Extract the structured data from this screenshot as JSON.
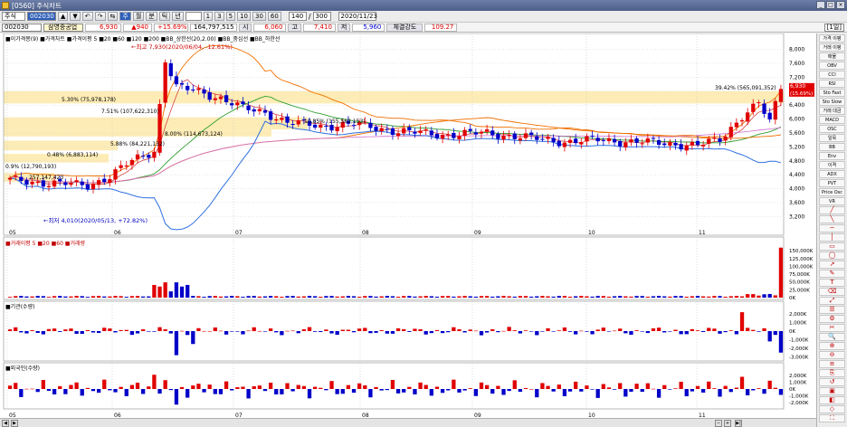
{
  "window": {
    "title": "[0560] 주식차트"
  },
  "toolbar": {
    "market": "주식",
    "code": "002030",
    "nav": [
      "▲",
      "▼",
      "↶",
      "↷",
      "⇆"
    ],
    "period_buttons": [
      "주",
      "월",
      "분",
      "틱",
      "년"
    ],
    "minute_buttons": [
      "1",
      "3",
      "5",
      "10",
      "30",
      "60"
    ],
    "count": "140",
    "count_total": "300",
    "date": "2020/11/23"
  },
  "infobar": {
    "code": "002030",
    "name": "삼영중공업",
    "price": "6,930",
    "change": "▲940",
    "change_pct": "+15.69%",
    "volume": "164,797,515",
    "open_label": "시",
    "open": "6,060",
    "high_label": "고",
    "high": "7,410",
    "low_label": "저",
    "low": "5,960",
    "strength_label": "체결강도",
    "strength": "109.27",
    "day_label": "[1일]"
  },
  "panels": {
    "price": {
      "legend": "■이가격봉(9) ■가격차트 ■가격이평 5 ■20 ■60 ■120 ■200 ■BB_상한선(20,2.00) ■BB_중심선 ■BB_하한선",
      "y_ticks": [
        "8,000",
        "7,600",
        "7,200",
        "6,800",
        "6,400",
        "6,000",
        "5,600",
        "5,200",
        "4,800",
        "4,400",
        "4,000",
        "3,600",
        "3,200"
      ],
      "price_tag_1": "6,930",
      "price_tag_2": "(15.69%)",
      "annotations": {
        "high": "←최고 7,930(2020/06/04, -12.61%)",
        "low": "←최저 4,010(2020/05/13, +72.82%)",
        "fibs": [
          "39.42% (565,091,352)",
          "5.30% (75,978,178)",
          "7.51% (107,622,310)",
          "10.85% (155,562,153)",
          "8.00% (114,673,124)",
          "5.88% (84,221,132)",
          "0.48% (6,883,114)",
          "0.9% (12,790,193)",
          "257,147,423"
        ]
      }
    },
    "volume": {
      "legend": "■거래이평 5 ■20 ■60 ■거래량",
      "y_ticks": [
        "150,000K",
        "125,000K",
        "100,000K",
        "75,000K",
        "50,000K",
        "25,000K",
        "0K"
      ]
    },
    "inst": {
      "legend": "■기관(수량)",
      "y_ticks": [
        "2,000K",
        "1,000K",
        "0K",
        "-1,000K",
        "-2,000K",
        "-3,000K"
      ]
    },
    "foreign": {
      "legend": "■외국인(수량)",
      "y_ticks": [
        "2,000K",
        "1,000K",
        "0K",
        "-1,000K",
        "-2,000K"
      ]
    }
  },
  "x_axis_labels": [
    "05",
    "06",
    "07",
    "08",
    "09",
    "10",
    "11"
  ],
  "right_sidebar": [
    "가격\n이평",
    "거래\n이평",
    "매물",
    "OBV",
    "CCI",
    "RSI",
    "Sto\nFast",
    "Sto\nSlow",
    "거래\n대금",
    "MACD",
    "OSC",
    "일목",
    "BB",
    "Env",
    "이격",
    "ADX",
    "PVT",
    "Price\nOsc",
    "VR"
  ],
  "colors": {
    "up": "#e00000",
    "down": "#0000c8",
    "ma5": "#d03030",
    "ma20": "#30a030",
    "ma60": "#f07000",
    "ma120": "#3070e0",
    "bb": "#d070d0",
    "fib_band": "#fde9a8"
  }
}
